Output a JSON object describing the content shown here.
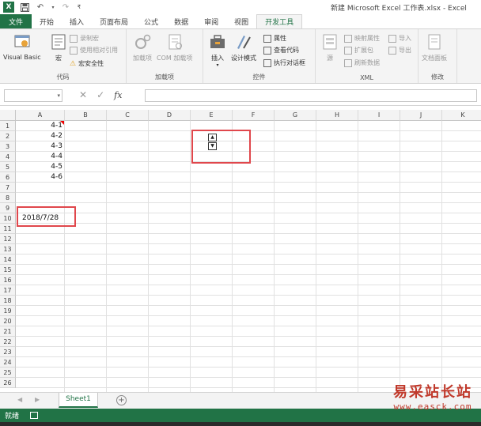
{
  "window": {
    "title": "新建 Microsoft Excel 工作表.xlsx - Excel"
  },
  "tabs": [
    "文件",
    "开始",
    "插入",
    "页面布局",
    "公式",
    "数据",
    "审阅",
    "视图",
    "开发工具"
  ],
  "active_tab": "开发工具",
  "ribbon": {
    "code_group": {
      "label": "代码",
      "visual_basic": "Visual Basic",
      "macros": "宏",
      "record_macro": "录制宏",
      "relative_ref": "使用相对引用",
      "macro_security": "宏安全性"
    },
    "addins_group": {
      "label": "加载项",
      "addins": "加载项",
      "com_addins": "COM 加载项"
    },
    "controls_group": {
      "label": "控件",
      "insert": "插入",
      "design_mode": "设计模式",
      "properties": "属性",
      "view_code": "查看代码",
      "run_dialog": "执行对话框"
    },
    "xml_group": {
      "label": "XML",
      "source": "源",
      "map_properties": "映射属性",
      "expansion_packs": "扩展包",
      "refresh_data": "刷新数据",
      "import": "导入",
      "export": "导出"
    },
    "modify_group": {
      "label": "修改",
      "document_panel": "文档面板"
    }
  },
  "formula_bar": {
    "name_box": "",
    "fx": "fx",
    "formula": ""
  },
  "columns": [
    "A",
    "B",
    "C",
    "D",
    "E",
    "F",
    "G",
    "H",
    "I",
    "J",
    "K"
  ],
  "rows": [
    "1",
    "2",
    "3",
    "4",
    "5",
    "6",
    "7",
    "8",
    "9",
    "10",
    "11",
    "12",
    "13",
    "14",
    "15",
    "16",
    "17",
    "18",
    "19",
    "20",
    "21",
    "22",
    "23",
    "24",
    "25",
    "26"
  ],
  "cells": {
    "A1": "4-1",
    "A2": "4-2",
    "A3": "4-3",
    "A4": "4-4",
    "A5": "4-5",
    "A6": "4-6",
    "A10": "2018/7/28"
  },
  "sheets": {
    "active": "Sheet1",
    "add": "+"
  },
  "status": {
    "ready": "就绪"
  },
  "watermark": {
    "title": "易采站长站",
    "url": "www.easck.com"
  },
  "colors": {
    "excel_green": "#217346",
    "highlight_red": "#e0474c"
  }
}
